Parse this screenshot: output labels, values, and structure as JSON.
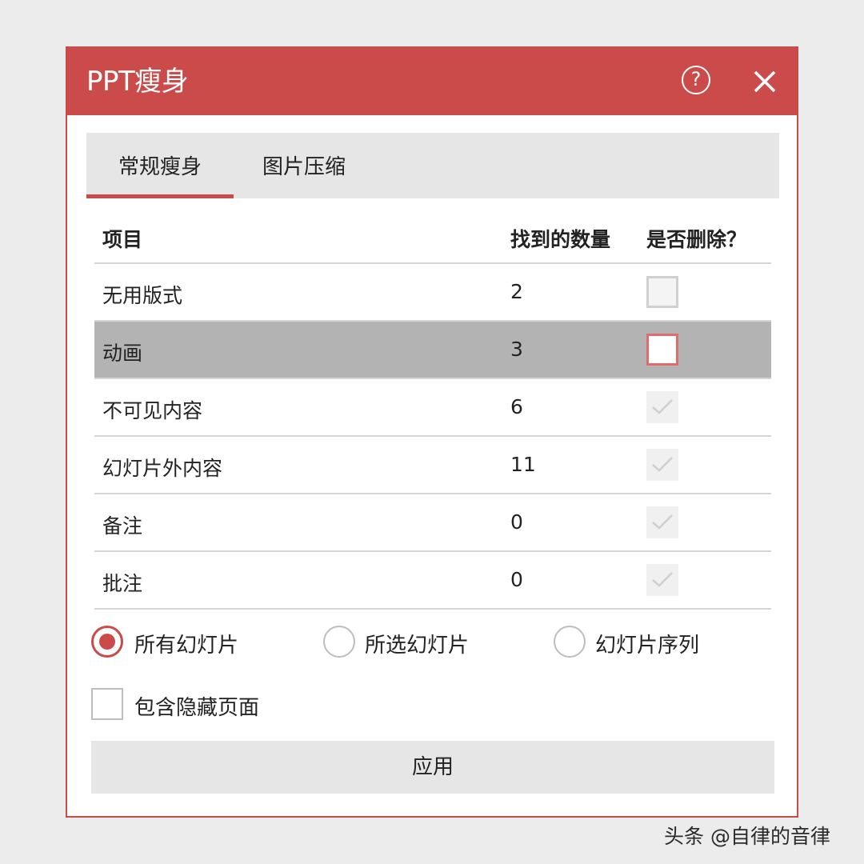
{
  "window": {
    "title": "PPT瘦身",
    "help_glyph": "?",
    "accent_color": "#cb4a4a"
  },
  "tabs": [
    {
      "label": "常规瘦身",
      "active": true
    },
    {
      "label": "图片压缩",
      "active": false
    }
  ],
  "table": {
    "headers": [
      "项目",
      "找到的数量",
      "是否删除？"
    ],
    "rows": [
      {
        "item": "无用版式",
        "count": "2",
        "checkbox": "unchecked"
      },
      {
        "item": "动画",
        "count": "3",
        "checkbox": "unchecked-focused",
        "selected": true
      },
      {
        "item": "不可见内容",
        "count": "6",
        "checkbox": "checked-disabled"
      },
      {
        "item": "幻灯片外内容",
        "count": "11",
        "checkbox": "checked-disabled"
      },
      {
        "item": "备注",
        "count": "0",
        "checkbox": "checked-disabled"
      },
      {
        "item": "批注",
        "count": "0",
        "checkbox": "checked-disabled"
      }
    ]
  },
  "scope": {
    "options": [
      {
        "label": "所有幻灯片",
        "selected": true
      },
      {
        "label": "所选幻灯片",
        "selected": false
      },
      {
        "label": "幻灯片序列",
        "selected": false
      }
    ]
  },
  "include_hidden": {
    "label": "包含隐藏页面",
    "checked": false
  },
  "apply_label": "应用",
  "watermark": "头条 @自律的音律"
}
